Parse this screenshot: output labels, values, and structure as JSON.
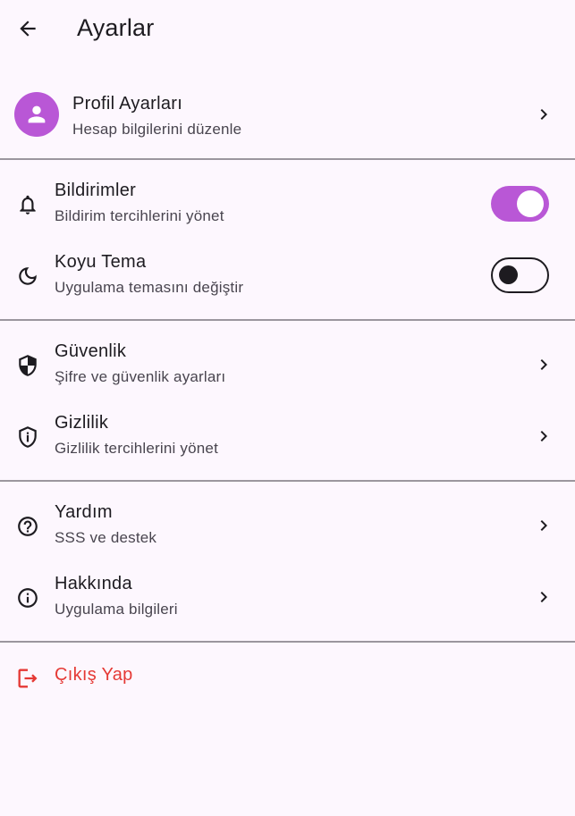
{
  "appbar": {
    "title": "Ayarlar",
    "back_icon": "arrow-back-icon"
  },
  "profile": {
    "title": "Profil Ayarları",
    "subtitle": "Hesap bilgilerini düzenle",
    "avatar_icon": "person-icon",
    "avatar_color": "#b957d6"
  },
  "notifications": {
    "title": "Bildirimler",
    "subtitle": "Bildirim tercihlerini yönet",
    "icon": "bell-icon",
    "enabled": true
  },
  "dark_theme": {
    "title": "Koyu Tema",
    "subtitle": "Uygulama temasını değiştir",
    "icon": "moon-icon",
    "enabled": false
  },
  "security": {
    "title": "Güvenlik",
    "subtitle": "Şifre ve güvenlik ayarları",
    "icon": "shield-icon"
  },
  "privacy": {
    "title": "Gizlilik",
    "subtitle": "Gizlilik tercihlerini yönet",
    "icon": "privacy-shield-icon"
  },
  "help": {
    "title": "Yardım",
    "subtitle": "SSS ve destek",
    "icon": "help-circle-icon"
  },
  "about": {
    "title": "Hakkında",
    "subtitle": "Uygulama bilgileri",
    "icon": "info-icon"
  },
  "logout": {
    "title": "Çıkış Yap",
    "icon": "logout-icon",
    "color": "#e53935"
  },
  "colors": {
    "accent": "#b957d6",
    "background": "#fdf7fe",
    "danger": "#e53935"
  }
}
